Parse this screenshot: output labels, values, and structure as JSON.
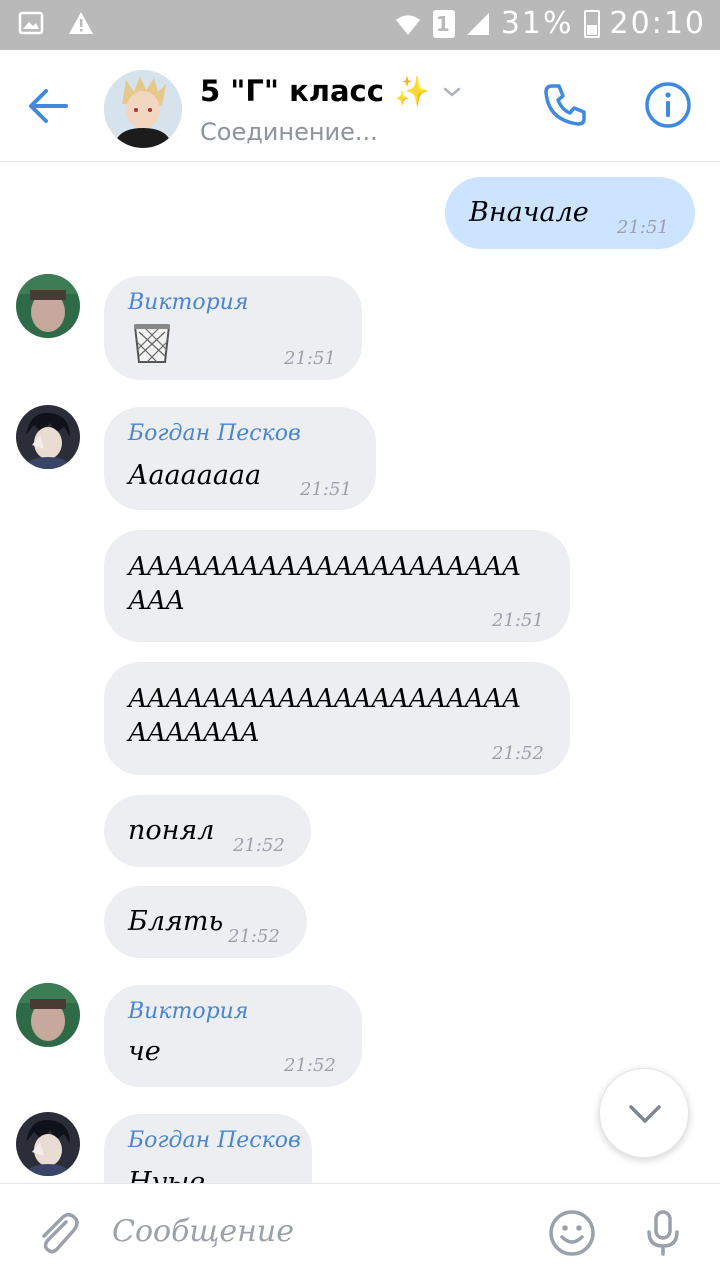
{
  "status_bar": {
    "sim_slot": "1",
    "battery": "31%",
    "time": "20:10"
  },
  "header": {
    "title": "5 \"Г\" класс ✨",
    "subtitle": "Соединение..."
  },
  "messages": [
    {
      "text": "Вначале",
      "time": "21:51"
    },
    {
      "author": "Виктория",
      "time": "21:51"
    },
    {
      "author": "Богдан Песков",
      "text": "Ааааaааа",
      "time": "21:51"
    },
    {
      "text": "ААААААААААААААААААААА\nААА",
      "time": "21:51"
    },
    {
      "text": "ААААААААААААААААААААА\nААААААА",
      "time": "21:52"
    },
    {
      "text": "понял",
      "time": "21:52"
    },
    {
      "text": "Блять",
      "time": "21:52"
    },
    {
      "author": "Виктория",
      "text": "че",
      "time": "21:52"
    },
    {
      "author": "Богдан Песков",
      "text": "Нуые"
    }
  ],
  "composer": {
    "placeholder": "Сообщение"
  },
  "colors": {
    "accent": "#3f8ae0",
    "incoming_bubble": "#eceef2",
    "outgoing_bubble": "#cce4ff",
    "status_bar": "#b9b9b9"
  }
}
